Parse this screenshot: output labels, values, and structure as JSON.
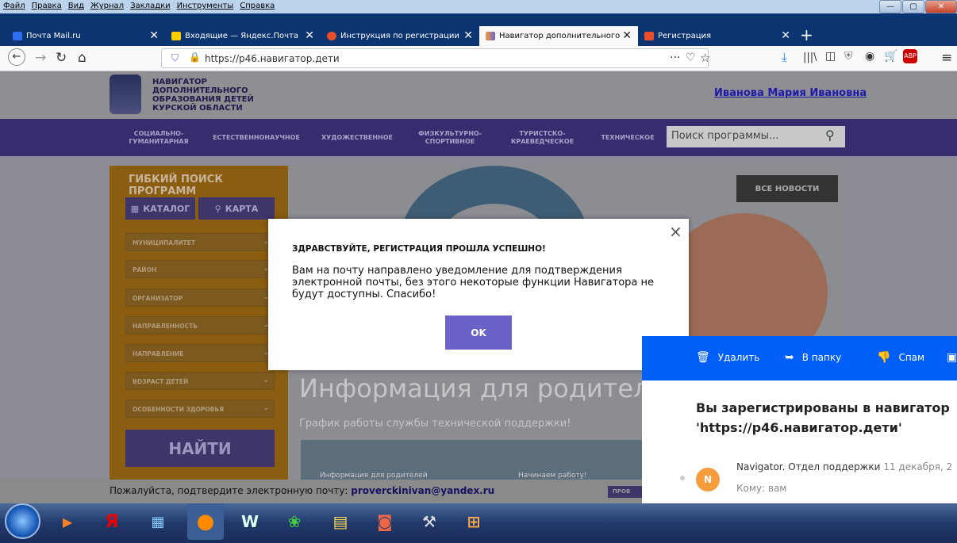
{
  "menubar": {
    "items": [
      "Файл",
      "Правка",
      "Вид",
      "Журнал",
      "Закладки",
      "Инструменты",
      "Справка"
    ]
  },
  "window_controls": {
    "minimize": "—",
    "maximize": "▢",
    "close": "✕"
  },
  "tabs": [
    {
      "label": "Почта Mail.ru",
      "color": "#005ff9",
      "active": false
    },
    {
      "label": "Входящие — Яндекс.Почта",
      "color": "#ffcc00",
      "active": false
    },
    {
      "label": "Инструкция по регистрации",
      "color": "#e84d2c",
      "active": false
    },
    {
      "label": "Навигатор дополнительного",
      "color": "#6a62c6",
      "active": true
    },
    {
      "label": "Регистрация",
      "color": "#e84d2c",
      "active": false
    }
  ],
  "toolbar": {
    "url": "https://p46.навигатор.дети",
    "dots": "···"
  },
  "site": {
    "logo_text": "НАВИГАТОР ДОПОЛНИТЕЛЬНОГО ОБРАЗОВАНИЯ ДЕТЕЙ КУРСКОЙ ОБЛАСТИ",
    "user_name": "Иванова Мария Ивановна",
    "nav": [
      "СОЦИАЛЬНО-ГУМАНИТАРНАЯ",
      "ЕСТЕСТВЕННОНАУЧНОЕ",
      "ХУДОЖЕСТВЕННОЕ",
      "ФИЗКУЛЬТУРНО-СПОРТИВНОЕ",
      "ТУРИСТСКО-КРАЕВЕДЧЕСКОЕ",
      "ТЕХНИЧЕСКОЕ"
    ],
    "search_placeholder": "Поиск программы...",
    "sidebar": {
      "title": "ГИБКИЙ ПОИСК ПРОГРАММ",
      "catalog_tab": "КАТАЛОГ",
      "map_tab": "КАРТА",
      "filters": [
        "МУНИЦИПАЛИТЕТ",
        "РАЙОН",
        "ОРГАНИЗАТОР",
        "НАПРАВЛЕННОСТЬ",
        "НАПРАВЛЕНИЕ",
        "ВОЗРАСТ ДЕТЕЙ",
        "ОСОБЕННОСТИ ЗДОРОВЬЯ"
      ],
      "find_button": "НАЙТИ"
    },
    "hero": {
      "all_news": "ВСЕ НОВОСТИ",
      "title": "Информация для родителей",
      "subtitle": "График работы службы технической поддержки!",
      "thumb1": "Информация для родителей",
      "thumb2": "Начинаем работу!"
    },
    "confirm": {
      "text": "Пожалуйста, подтвердите электронную почту:",
      "email": "proverckinivan@yandex.ru",
      "button": "ПРОВ"
    }
  },
  "modal": {
    "title": "ЗДРАВСТВУЙТЕ, РЕГИСТРАЦИЯ ПРОШЛА УСПЕШНО!",
    "body": "Вам на почту направлено уведомление для подтверждения электронной почты,  без этого некоторые функции Навигатора не будут доступны. Спасибо!",
    "ok": "OK",
    "close": "×"
  },
  "mail": {
    "actions": {
      "delete": "Удалить",
      "folder": "В папку",
      "spam": "Спам"
    },
    "subject": "Вы зарегистрированы в навигатор 'https://p46.навигатор.дети'",
    "avatar_letter": "N",
    "sender": "Navigator. Отдел поддержки",
    "date": "11 декабря, 2",
    "recipient": "Кому: вам"
  },
  "taskbar": {
    "items": [
      "media-player-icon",
      "yandex-browser-icon",
      "control-panel-icon",
      "firefox-icon",
      "word-icon",
      "icq-icon",
      "explorer-icon",
      "presentation-icon",
      "tools-icon",
      "paint-icon"
    ]
  }
}
